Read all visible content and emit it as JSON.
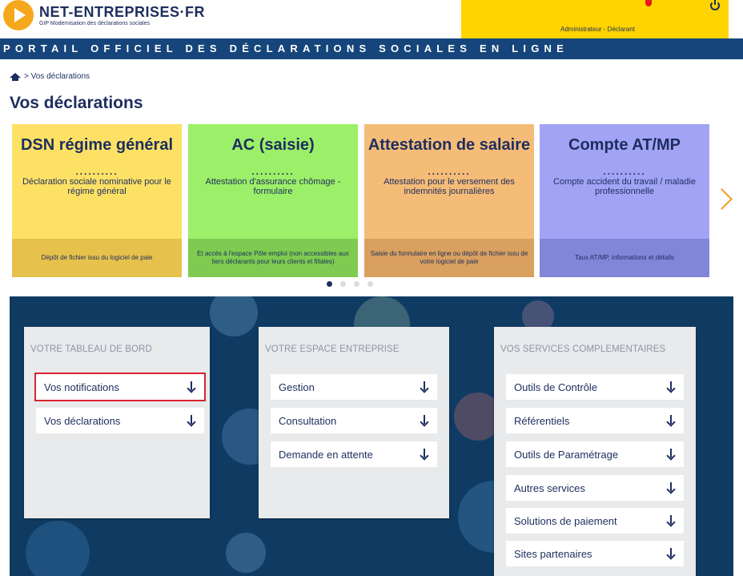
{
  "header": {
    "logo_title": "NET-ENTREPRISES·FR",
    "logo_subtitle": "GIP Modernisation des déclarations sociales",
    "user_role": "Administrateur - Déclarant",
    "portal_banner": "PORTAIL OFFICIEL DES DÉCLARATIONS SOCIALES EN LIGNE"
  },
  "breadcrumb": {
    "separator": ">",
    "current": "Vos déclarations"
  },
  "page_title": "Vos déclarations",
  "cards": [
    {
      "title": "DSN régime général",
      "dots": "..........",
      "subtitle": "Déclaration sociale nominative pour le régime général",
      "footer": "Dépôt de fichier issu du logiciel de paie"
    },
    {
      "title": "AC (saisie)",
      "dots": "..........",
      "subtitle": "Attestation d'assurance chômage - formulaire",
      "footer": "Et accès à l'espace Pôle emploi (non accessibles aux tiers déclarants pour leurs clients et filiales)"
    },
    {
      "title": "Attestation de salaire",
      "dots": "..........",
      "subtitle": "Attestation pour le versement des indemnités journalières",
      "footer": "Saisie du formulaire en ligne ou dépôt de fichier issu de votre logiciel de paie"
    },
    {
      "title": "Compte AT/MP",
      "dots": "..........",
      "subtitle": "Compte accident du travail / maladie professionnelle",
      "footer": "Taux AT/MP, informations et détails"
    }
  ],
  "carousel": {
    "pages": 4,
    "active_index": 0
  },
  "panels": [
    {
      "heading": "VOTRE TABLEAU DE BORD",
      "items": [
        "Vos notifications",
        "Vos déclarations"
      ]
    },
    {
      "heading": "VOTRE ESPACE ENTREPRISE",
      "items": [
        "Gestion",
        "Consultation",
        "Demande en attente"
      ]
    },
    {
      "heading": "VOS SERVICES COMPLEMENTAIRES",
      "items": [
        "Outils de Contrôle",
        "Référentiels",
        "Outils de Paramétrage",
        "Autres services",
        "Solutions de paiement",
        "Sites partenaires"
      ]
    }
  ],
  "colors": {
    "navy": "#1d2e5e",
    "header_yellow": "#ffd400",
    "banner_blue": "#16457b",
    "card_yellow": "#fde165",
    "card_green": "#9cef68",
    "card_orange": "#f5bc78",
    "card_violet": "#a2a3f5",
    "selection_red": "#d9232e"
  }
}
